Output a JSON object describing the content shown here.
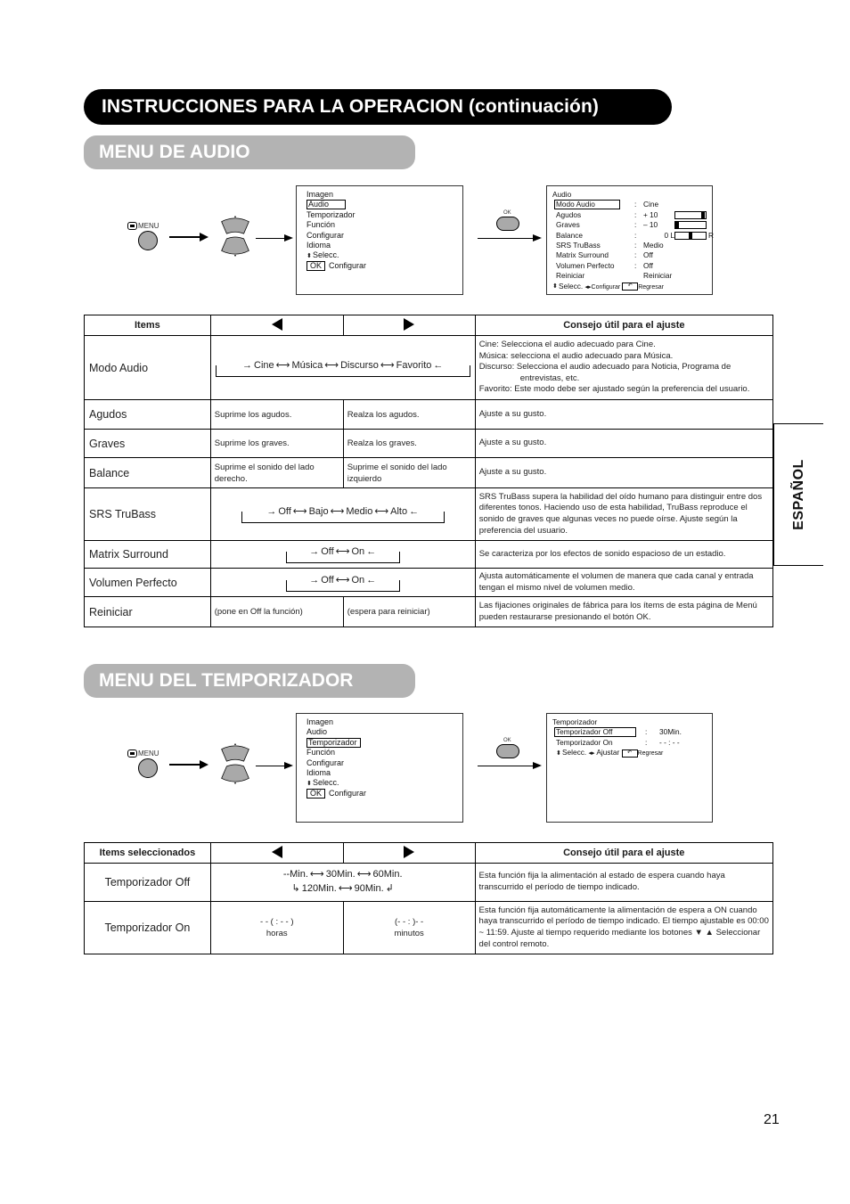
{
  "header": {
    "title": "INSTRUCCIONES PARA LA OPERACION (continuación)"
  },
  "language_tab": "ESPAÑOL",
  "page_number": "21",
  "audio_section": {
    "title": "MENU DE AUDIO",
    "remote": {
      "menu_label": "MENU",
      "ok_label": "OK"
    },
    "main_menu": {
      "items": [
        "Imagen",
        "Audio",
        "Temporizador",
        "Función",
        "Configurar",
        "Idioma"
      ],
      "selected": "Audio",
      "nav_select": "Selecc.",
      "ok_key": "OK",
      "ok_action": "Configurar"
    },
    "audio_menu": {
      "title": "Audio",
      "rows": [
        {
          "label": "Modo Audio",
          "value": "Cine",
          "selected": true
        },
        {
          "label": "Agudos",
          "value": "+ 10",
          "bar_level": 1.0
        },
        {
          "label": "Graves",
          "value": "– 10",
          "bar_level": 0.0
        },
        {
          "label": "Balance",
          "value": "0 L",
          "suffix": "R",
          "bar_level": 0.5
        },
        {
          "label": "SRS TruBass",
          "value": "Medio"
        },
        {
          "label": "Matrix Surround",
          "value": "Off"
        },
        {
          "label": "Volumen Perfecto",
          "value": "Off"
        },
        {
          "label": "Reiniciar",
          "value": "Reiniciar"
        }
      ],
      "footer": {
        "select": "Selecc.",
        "adjust": "Configurar",
        "return": "Regresar"
      }
    },
    "table": {
      "headers": {
        "items": "Items",
        "tip": "Consejo útil para el ajuste"
      },
      "rows": [
        {
          "item": "Modo Audio",
          "cycle": [
            "Cine",
            "Música",
            "Discurso",
            "Favorito"
          ],
          "tip_lines": [
            "Cine: Selecciona el audio adecuado para Cine.",
            "Música: selecciona el audio adecuado para Música.",
            "Discurso: Selecciona el audio adecuado para Noticia, Programa de",
            "entrevistas, etc.",
            "Favorito: Este modo debe ser ajustado según la preferencia del usuario."
          ]
        },
        {
          "item": "Agudos",
          "left": "Suprime los agudos.",
          "right": "Realza los agudos.",
          "tip": "Ajuste a su gusto."
        },
        {
          "item": "Graves",
          "left": "Suprime los graves.",
          "right": "Realza los graves.",
          "tip": "Ajuste a su gusto."
        },
        {
          "item": "Balance",
          "left": "Suprime el sonido del lado derecho.",
          "right": "Suprime el sonido del lado izquierdo",
          "tip": "Ajuste a su gusto."
        },
        {
          "item": "SRS TruBass",
          "cycle": [
            "Off",
            "Bajo",
            "Medio",
            "Alto"
          ],
          "tip": "SRS TruBass supera la habilidad del oído humano para distinguir entre dos diferentes tonos. Haciendo uso de esta habilidad, TruBass reproduce el sonido de graves que algunas veces no puede oírse. Ajuste según la preferencia del usuario."
        },
        {
          "item": "Matrix Surround",
          "cycle": [
            "Off",
            "On"
          ],
          "tip": "Se caracteriza por los efectos de sonido espacioso de un estadio."
        },
        {
          "item": "Volumen Perfecto",
          "cycle": [
            "Off",
            "On"
          ],
          "tip": "Ajusta automáticamente el volumen de manera que cada canal y entrada tengan el mismo nivel de volumen medio."
        },
        {
          "item": "Reiniciar",
          "left": "(pone en Off la función)",
          "right": "(espera para reiniciar)",
          "tip": "Las fijaciones originales de fábrica para los ítems de esta página de Menú pueden restaurarse presionando el botón OK."
        }
      ]
    }
  },
  "timer_section": {
    "title": "MENU DEL TEMPORIZADOR",
    "remote": {
      "menu_label": "MENU",
      "ok_label": "OK"
    },
    "main_menu": {
      "items": [
        "Imagen",
        "Audio",
        "Temporizador",
        "Función",
        "Configurar",
        "Idioma"
      ],
      "selected": "Temporizador",
      "nav_select": "Selecc.",
      "ok_key": "OK",
      "ok_action": "Configurar"
    },
    "timer_menu": {
      "title": "Temporizador",
      "rows": [
        {
          "label": "Temporizador Off",
          "value": "30Min.",
          "selected": true
        },
        {
          "label": "Temporizador On",
          "value": "- - : - -"
        }
      ],
      "footer": {
        "select": "Selecc.",
        "adjust": "Ajustar",
        "return": "Regresar"
      }
    },
    "table": {
      "headers": {
        "items": "Items seleccionados",
        "tip": "Consejo útil para el ajuste"
      },
      "rows": [
        {
          "item": "Temporizador Off",
          "cycle_top": [
            "--Min.",
            "30Min.",
            "60Min."
          ],
          "cycle_bottom": [
            "120Min.",
            "90Min."
          ],
          "tip": "Esta función fija la alimentación al estado de espera cuando haya transcurrido el período de tiempo indicado."
        },
        {
          "item": "Temporizador On",
          "left": "- - ( : - - )",
          "left_sub": "horas",
          "right": "(- -  : )- -",
          "right_sub": "minutos",
          "tip": "Esta función fija automáticamente la alimentación de espera a ON cuando haya transcurrido el período de tiempo indicado. El tiempo ajustable es 00:00 ~ 11:59. Ajuste al tiempo requerido mediante los botones ▼ ▲ Seleccionar del control remoto."
        }
      ]
    }
  }
}
